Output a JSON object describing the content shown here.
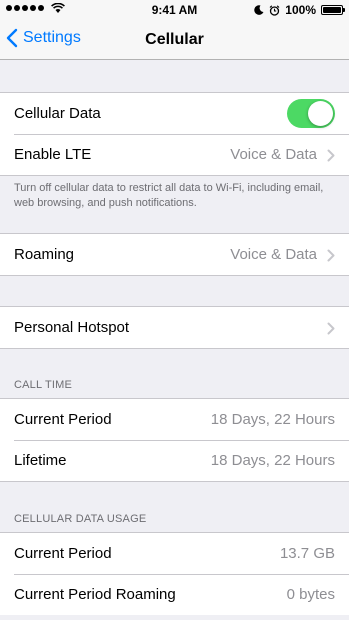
{
  "status_bar": {
    "time": "9:41 AM",
    "battery": "100%",
    "battery_level": 1.0,
    "signal_bars_filled": 5
  },
  "nav": {
    "back_label": "Settings",
    "title": "Cellular"
  },
  "cellular": {
    "cellular_data_label": "Cellular Data",
    "cellular_data_on": true,
    "enable_lte_label": "Enable LTE",
    "enable_lte_value": "Voice & Data",
    "footer": "Turn off cellular data to restrict all data to Wi-Fi, including email, web browsing, and push notifications."
  },
  "roaming": {
    "label": "Roaming",
    "value": "Voice & Data"
  },
  "hotspot": {
    "label": "Personal Hotspot"
  },
  "call_time": {
    "header": "CALL TIME",
    "rows": [
      {
        "label": "Current Period",
        "value": "18 Days, 22 Hours"
      },
      {
        "label": "Lifetime",
        "value": "18 Days, 22 Hours"
      }
    ]
  },
  "data_usage": {
    "header": "CELLULAR DATA USAGE",
    "rows": [
      {
        "label": "Current Period",
        "value": "13.7 GB"
      },
      {
        "label": "Current Period Roaming",
        "value": "0 bytes"
      }
    ]
  },
  "colors": {
    "accent": "#007aff",
    "toggle_on": "#4cd964",
    "background": "#efeff4",
    "secondary_text": "#8e8e93"
  },
  "icons": [
    "signal-dots-icon",
    "wifi-icon",
    "moon-icon",
    "alarm-clock-icon",
    "battery-icon",
    "back-chevron-icon",
    "chevron-right-icon"
  ]
}
